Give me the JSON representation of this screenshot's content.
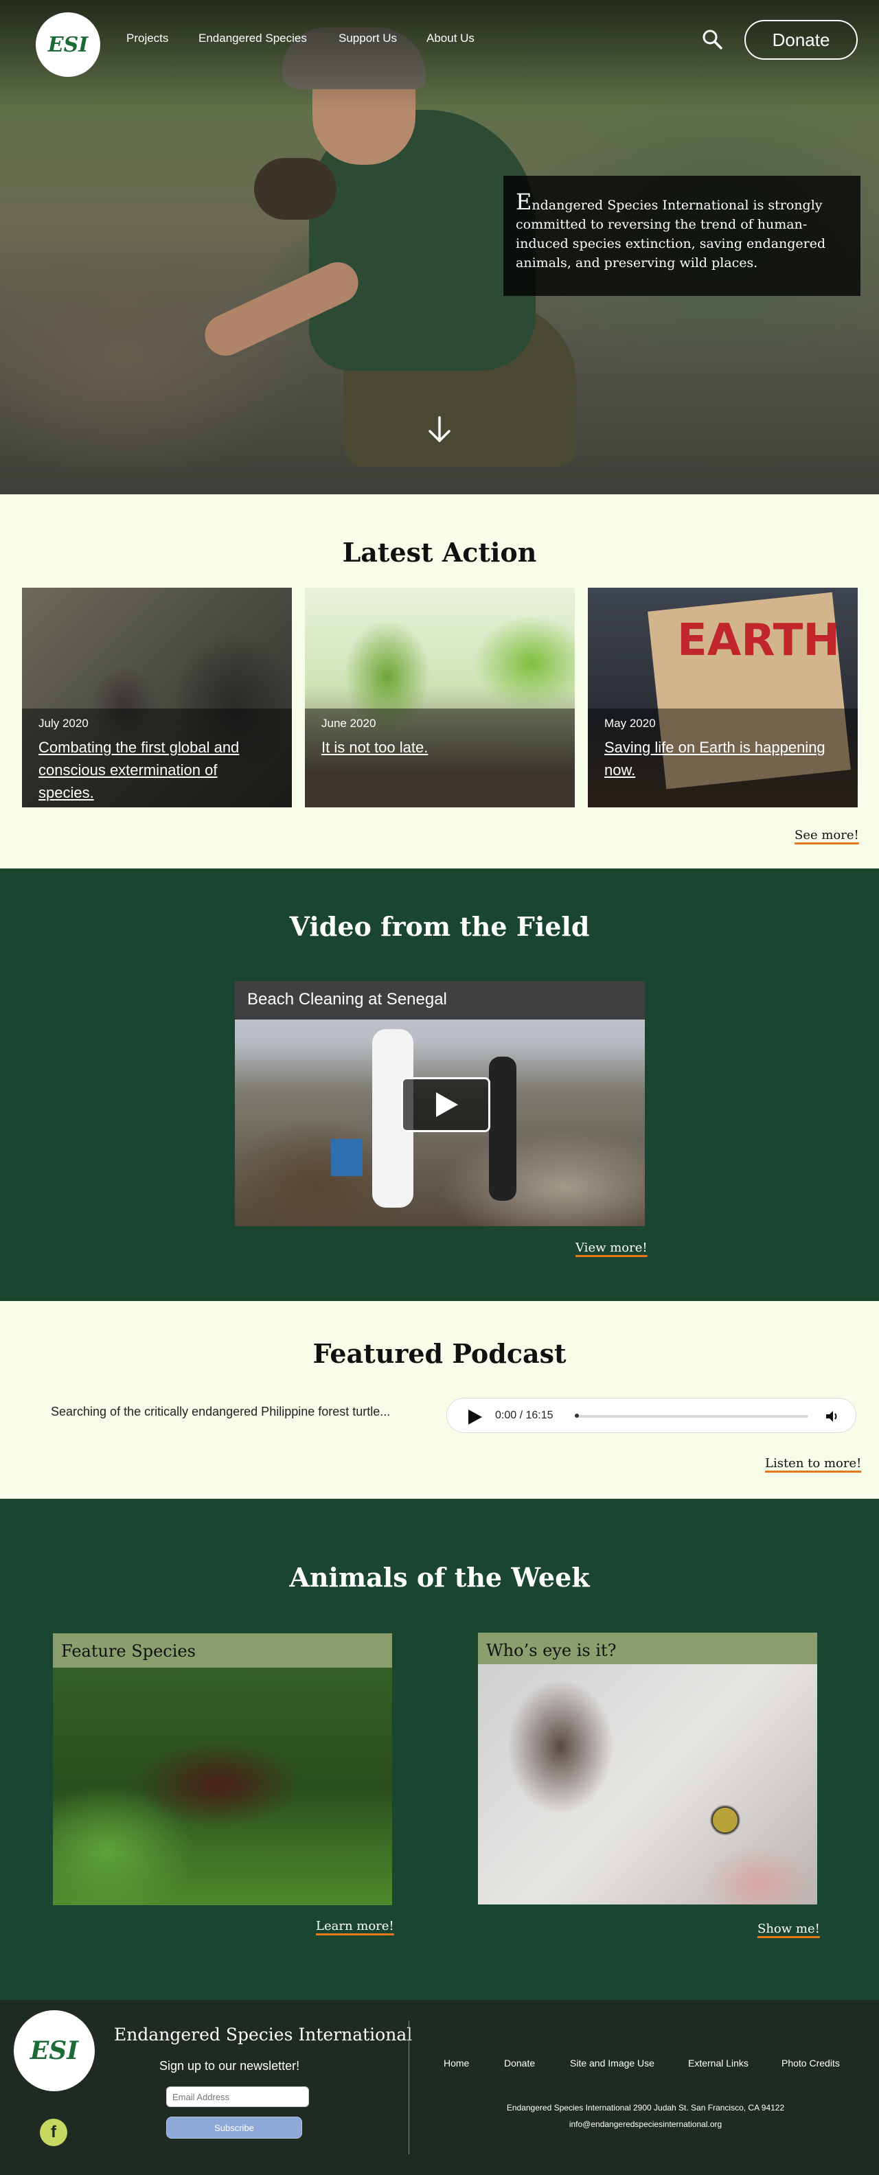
{
  "nav": {
    "logo_text": "ESI",
    "links": [
      "Projects",
      "Endangered Species",
      "Support Us",
      "About Us"
    ],
    "donate_label": "Donate",
    "search_icon": "search-icon"
  },
  "hero": {
    "quote_first": "E",
    "quote_rest": "ndangered Species International is strongly committed to reversing the trend of human-induced species extinction, saving endangered animals, and preserving wild places.",
    "scroll_icon": "arrow-down-icon"
  },
  "latest": {
    "title": "Latest Action",
    "cards": [
      {
        "date": "July 2020",
        "title": "Combating the first global and conscious extermination of species."
      },
      {
        "date": "June 2020",
        "title": "It is not too late."
      },
      {
        "date": "May 2020",
        "title": "Saving life on Earth is happening now."
      }
    ],
    "card3_sign_text": "EARTH",
    "more": "See more!"
  },
  "video": {
    "title": "Video from the Field",
    "video_title": "Beach Cleaning at Senegal",
    "more": "View more!"
  },
  "podcast": {
    "title": "Featured Podcast",
    "description": "Searching of the critically endangered Philippine forest turtle...",
    "time": "0:00 / 16:15",
    "more": "Listen to more!"
  },
  "animals": {
    "title": "Animals of the Week",
    "cards": [
      {
        "heading": "Feature Species",
        "link": "Learn more!"
      },
      {
        "heading": "Who’s eye is it?",
        "link": "Show me!"
      }
    ]
  },
  "footer": {
    "logo_text": "ESI",
    "org_name": "Endangered Species International",
    "newsletter": "Sign up to our newsletter!",
    "email_placeholder": "Email Address",
    "subscribe": "Subscribe",
    "facebook": "f",
    "links": [
      "Home",
      "Donate",
      "Site and Image Use",
      "External Links",
      "Photo Credits"
    ],
    "address": "Endangered Species International 2900 Judah St. San Francisco, CA 94122",
    "email": "info@endangeredspeciesinternational.org"
  },
  "colors": {
    "dark_green": "#1a4531",
    "cream": "#f7fde9",
    "accent_orange": "#e8761b",
    "card_header": "#8b9e6d",
    "footer_bg": "#1e2a22"
  }
}
